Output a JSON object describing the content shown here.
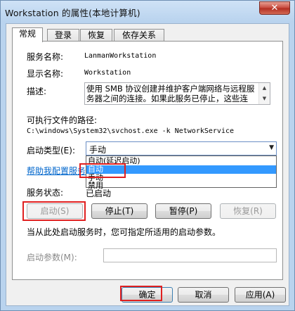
{
  "window": {
    "title": "Workstation 的属性(本地计算机)",
    "close_glyph": "✕"
  },
  "tabs": [
    {
      "label": "常规",
      "active": true
    },
    {
      "label": "登录",
      "active": false
    },
    {
      "label": "恢复",
      "active": false
    },
    {
      "label": "依存关系",
      "active": false
    }
  ],
  "general": {
    "service_name_label": "服务名称:",
    "service_name_value": "LanmanWorkstation",
    "display_name_label": "显示名称:",
    "display_name_value": "Workstation",
    "description_label": "描述:",
    "description_text": "使用 SMB 协议创建并维护客户端网络与远程服务器之间的连接。如果此服务已停止，这些连",
    "exe_path_label": "可执行文件的路径:",
    "exe_path_value": "C:\\windows\\System32\\svchost.exe -k NetworkService",
    "startup_type_label": "启动类型(E):",
    "startup_type_value": "手动",
    "startup_options": [
      "自动(延迟启动)",
      "自动",
      "手动",
      "禁用"
    ],
    "startup_selected": "自动",
    "help_link": "帮助我配置服务",
    "service_status_label": "服务状态:",
    "service_status_value": "已启动",
    "start_button": "启动(S)",
    "stop_button": "停止(T)",
    "pause_button": "暂停(P)",
    "resume_button": "恢复(R)",
    "hint_text": "当从此处启动服务时，您可指定所适用的启动参数。",
    "start_params_label": "启动参数(M):",
    "start_params_value": ""
  },
  "footer": {
    "ok_button": "确定",
    "cancel_button": "取消",
    "apply_button": "应用(A)"
  },
  "icons": {
    "dropdown_arrow": "▼",
    "scroll_up": "▲",
    "scroll_down": "▼"
  },
  "colors": {
    "selection": "#3399ff",
    "link": "#0066cc",
    "highlight_box": "#e02020"
  }
}
